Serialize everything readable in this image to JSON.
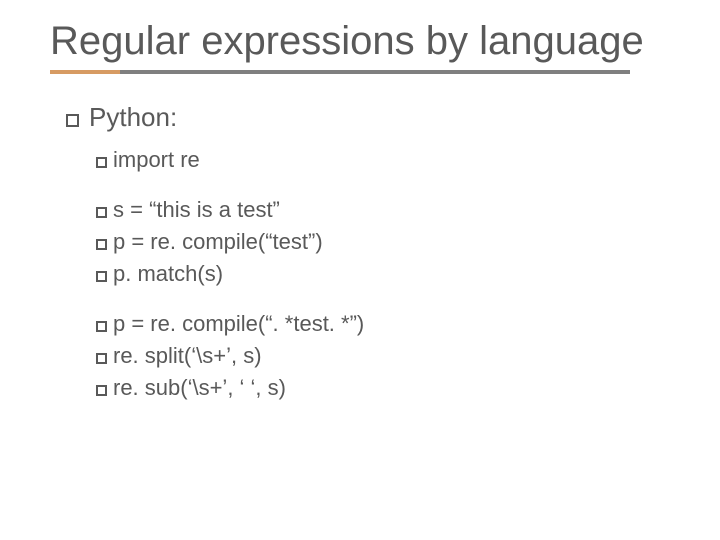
{
  "title": "Regular expressions by language",
  "heading": "Python:",
  "block1": {
    "l1": "import re"
  },
  "block2": {
    "l1": "s = “this is a test”",
    "l2": "p = re. compile(“test”)",
    "l3": "p. match(s)"
  },
  "block3": {
    "l1": "p = re. compile(“. *test. *”)",
    "l2": "re. split(‘\\s+’, s)",
    "l3": "re. sub(‘\\s+’, ‘ ‘, s)"
  }
}
